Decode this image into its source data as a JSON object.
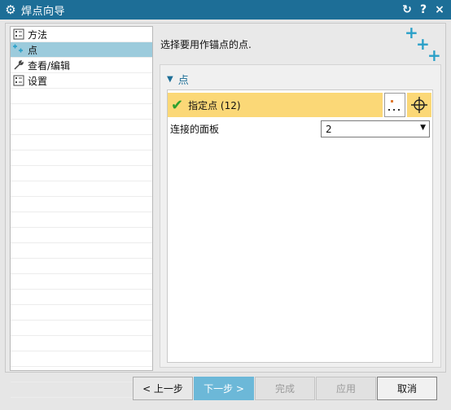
{
  "window": {
    "title": "焊点向导",
    "actions": [
      "↻",
      "?",
      "×"
    ]
  },
  "sidebar": {
    "items": [
      {
        "label": "方法",
        "icon": "method-list-icon",
        "selected": false
      },
      {
        "label": "点",
        "icon": "point-plus-icon",
        "selected": true
      },
      {
        "label": "查看/编辑",
        "icon": "wrench-icon",
        "selected": false
      },
      {
        "label": "设置",
        "icon": "settings-list-icon",
        "selected": false
      }
    ]
  },
  "main": {
    "instruction": "选择要用作锚点的点.",
    "group": {
      "title": "点",
      "specify_point_label": "指定点 (12)",
      "panel_count_label": "连接的面板",
      "panel_count_value": "2"
    }
  },
  "footer": {
    "back": "< 上一步",
    "next": "下一步 >",
    "finish": "完成",
    "apply": "应用",
    "cancel": "取消"
  },
  "colors": {
    "titlebar": "#1d6e97",
    "selection": "#9ccbdc",
    "highlight": "#fbd877",
    "accent": "#2aa0c8",
    "check": "#2ea12e"
  }
}
